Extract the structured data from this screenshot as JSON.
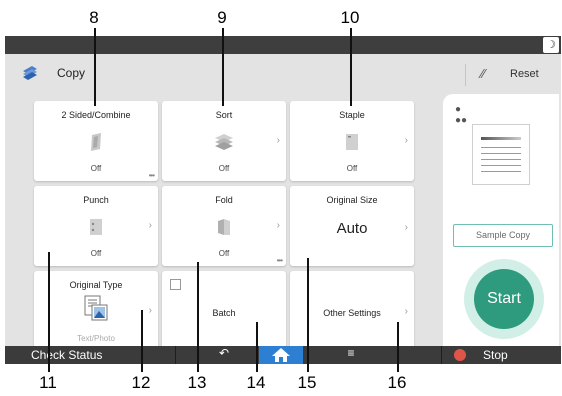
{
  "callouts": {
    "top": [
      "8",
      "9",
      "10"
    ],
    "bottom": [
      "11",
      "12",
      "13",
      "14",
      "15",
      "16"
    ]
  },
  "header": {
    "app_icon": "copy-app-icon",
    "title": "Copy",
    "reset_icon": "reset-icon",
    "reset_label": "Reset",
    "mode_icon": "moon-icon"
  },
  "tiles": {
    "duplex": {
      "label": "2 Sided/Combine",
      "state": "Off"
    },
    "sort": {
      "label": "Sort",
      "state": "Off"
    },
    "staple": {
      "label": "Staple",
      "state": "Off"
    },
    "punch": {
      "label": "Punch",
      "state": "Off"
    },
    "fold": {
      "label": "Fold",
      "state": "Off"
    },
    "original_size": {
      "label": "Original Size",
      "value": "Auto"
    },
    "original_type": {
      "label": "Original Type",
      "state": "Text/Photo"
    },
    "batch": {
      "label": "Batch"
    },
    "other_settings": {
      "label": "Other Settings"
    }
  },
  "right_panel": {
    "sample_copy": "Sample Copy",
    "start": "Start"
  },
  "bottom_bar": {
    "check_status": "Check Status",
    "back_icon": "back-icon",
    "home_icon": "home-icon",
    "menu_icon": "menu-icon",
    "stop": "Stop"
  },
  "colors": {
    "start_button": "#2e9a7e",
    "home_button": "#2d7fd1",
    "stop_icon": "#e05547",
    "sample_border": "#6fbeb2",
    "bar": "#3b3b3b",
    "panel_bg": "#e3e3e3"
  }
}
